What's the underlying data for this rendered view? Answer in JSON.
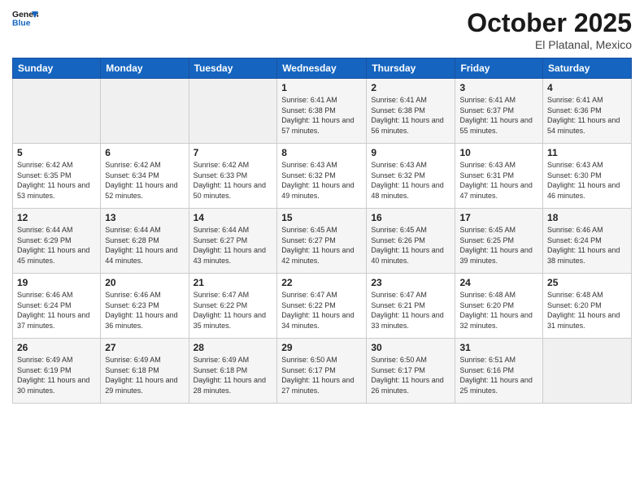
{
  "header": {
    "logo_line1": "General",
    "logo_line2": "Blue",
    "month": "October 2025",
    "location": "El Platanal, Mexico"
  },
  "days_of_week": [
    "Sunday",
    "Monday",
    "Tuesday",
    "Wednesday",
    "Thursday",
    "Friday",
    "Saturday"
  ],
  "weeks": [
    [
      {
        "day": "",
        "sunrise": "",
        "sunset": "",
        "daylight": ""
      },
      {
        "day": "",
        "sunrise": "",
        "sunset": "",
        "daylight": ""
      },
      {
        "day": "",
        "sunrise": "",
        "sunset": "",
        "daylight": ""
      },
      {
        "day": "1",
        "sunrise": "Sunrise: 6:41 AM",
        "sunset": "Sunset: 6:38 PM",
        "daylight": "Daylight: 11 hours and 57 minutes."
      },
      {
        "day": "2",
        "sunrise": "Sunrise: 6:41 AM",
        "sunset": "Sunset: 6:38 PM",
        "daylight": "Daylight: 11 hours and 56 minutes."
      },
      {
        "day": "3",
        "sunrise": "Sunrise: 6:41 AM",
        "sunset": "Sunset: 6:37 PM",
        "daylight": "Daylight: 11 hours and 55 minutes."
      },
      {
        "day": "4",
        "sunrise": "Sunrise: 6:41 AM",
        "sunset": "Sunset: 6:36 PM",
        "daylight": "Daylight: 11 hours and 54 minutes."
      }
    ],
    [
      {
        "day": "5",
        "sunrise": "Sunrise: 6:42 AM",
        "sunset": "Sunset: 6:35 PM",
        "daylight": "Daylight: 11 hours and 53 minutes."
      },
      {
        "day": "6",
        "sunrise": "Sunrise: 6:42 AM",
        "sunset": "Sunset: 6:34 PM",
        "daylight": "Daylight: 11 hours and 52 minutes."
      },
      {
        "day": "7",
        "sunrise": "Sunrise: 6:42 AM",
        "sunset": "Sunset: 6:33 PM",
        "daylight": "Daylight: 11 hours and 50 minutes."
      },
      {
        "day": "8",
        "sunrise": "Sunrise: 6:43 AM",
        "sunset": "Sunset: 6:32 PM",
        "daylight": "Daylight: 11 hours and 49 minutes."
      },
      {
        "day": "9",
        "sunrise": "Sunrise: 6:43 AM",
        "sunset": "Sunset: 6:32 PM",
        "daylight": "Daylight: 11 hours and 48 minutes."
      },
      {
        "day": "10",
        "sunrise": "Sunrise: 6:43 AM",
        "sunset": "Sunset: 6:31 PM",
        "daylight": "Daylight: 11 hours and 47 minutes."
      },
      {
        "day": "11",
        "sunrise": "Sunrise: 6:43 AM",
        "sunset": "Sunset: 6:30 PM",
        "daylight": "Daylight: 11 hours and 46 minutes."
      }
    ],
    [
      {
        "day": "12",
        "sunrise": "Sunrise: 6:44 AM",
        "sunset": "Sunset: 6:29 PM",
        "daylight": "Daylight: 11 hours and 45 minutes."
      },
      {
        "day": "13",
        "sunrise": "Sunrise: 6:44 AM",
        "sunset": "Sunset: 6:28 PM",
        "daylight": "Daylight: 11 hours and 44 minutes."
      },
      {
        "day": "14",
        "sunrise": "Sunrise: 6:44 AM",
        "sunset": "Sunset: 6:27 PM",
        "daylight": "Daylight: 11 hours and 43 minutes."
      },
      {
        "day": "15",
        "sunrise": "Sunrise: 6:45 AM",
        "sunset": "Sunset: 6:27 PM",
        "daylight": "Daylight: 11 hours and 42 minutes."
      },
      {
        "day": "16",
        "sunrise": "Sunrise: 6:45 AM",
        "sunset": "Sunset: 6:26 PM",
        "daylight": "Daylight: 11 hours and 40 minutes."
      },
      {
        "day": "17",
        "sunrise": "Sunrise: 6:45 AM",
        "sunset": "Sunset: 6:25 PM",
        "daylight": "Daylight: 11 hours and 39 minutes."
      },
      {
        "day": "18",
        "sunrise": "Sunrise: 6:46 AM",
        "sunset": "Sunset: 6:24 PM",
        "daylight": "Daylight: 11 hours and 38 minutes."
      }
    ],
    [
      {
        "day": "19",
        "sunrise": "Sunrise: 6:46 AM",
        "sunset": "Sunset: 6:24 PM",
        "daylight": "Daylight: 11 hours and 37 minutes."
      },
      {
        "day": "20",
        "sunrise": "Sunrise: 6:46 AM",
        "sunset": "Sunset: 6:23 PM",
        "daylight": "Daylight: 11 hours and 36 minutes."
      },
      {
        "day": "21",
        "sunrise": "Sunrise: 6:47 AM",
        "sunset": "Sunset: 6:22 PM",
        "daylight": "Daylight: 11 hours and 35 minutes."
      },
      {
        "day": "22",
        "sunrise": "Sunrise: 6:47 AM",
        "sunset": "Sunset: 6:22 PM",
        "daylight": "Daylight: 11 hours and 34 minutes."
      },
      {
        "day": "23",
        "sunrise": "Sunrise: 6:47 AM",
        "sunset": "Sunset: 6:21 PM",
        "daylight": "Daylight: 11 hours and 33 minutes."
      },
      {
        "day": "24",
        "sunrise": "Sunrise: 6:48 AM",
        "sunset": "Sunset: 6:20 PM",
        "daylight": "Daylight: 11 hours and 32 minutes."
      },
      {
        "day": "25",
        "sunrise": "Sunrise: 6:48 AM",
        "sunset": "Sunset: 6:20 PM",
        "daylight": "Daylight: 11 hours and 31 minutes."
      }
    ],
    [
      {
        "day": "26",
        "sunrise": "Sunrise: 6:49 AM",
        "sunset": "Sunset: 6:19 PM",
        "daylight": "Daylight: 11 hours and 30 minutes."
      },
      {
        "day": "27",
        "sunrise": "Sunrise: 6:49 AM",
        "sunset": "Sunset: 6:18 PM",
        "daylight": "Daylight: 11 hours and 29 minutes."
      },
      {
        "day": "28",
        "sunrise": "Sunrise: 6:49 AM",
        "sunset": "Sunset: 6:18 PM",
        "daylight": "Daylight: 11 hours and 28 minutes."
      },
      {
        "day": "29",
        "sunrise": "Sunrise: 6:50 AM",
        "sunset": "Sunset: 6:17 PM",
        "daylight": "Daylight: 11 hours and 27 minutes."
      },
      {
        "day": "30",
        "sunrise": "Sunrise: 6:50 AM",
        "sunset": "Sunset: 6:17 PM",
        "daylight": "Daylight: 11 hours and 26 minutes."
      },
      {
        "day": "31",
        "sunrise": "Sunrise: 6:51 AM",
        "sunset": "Sunset: 6:16 PM",
        "daylight": "Daylight: 11 hours and 25 minutes."
      },
      {
        "day": "",
        "sunrise": "",
        "sunset": "",
        "daylight": ""
      }
    ]
  ]
}
